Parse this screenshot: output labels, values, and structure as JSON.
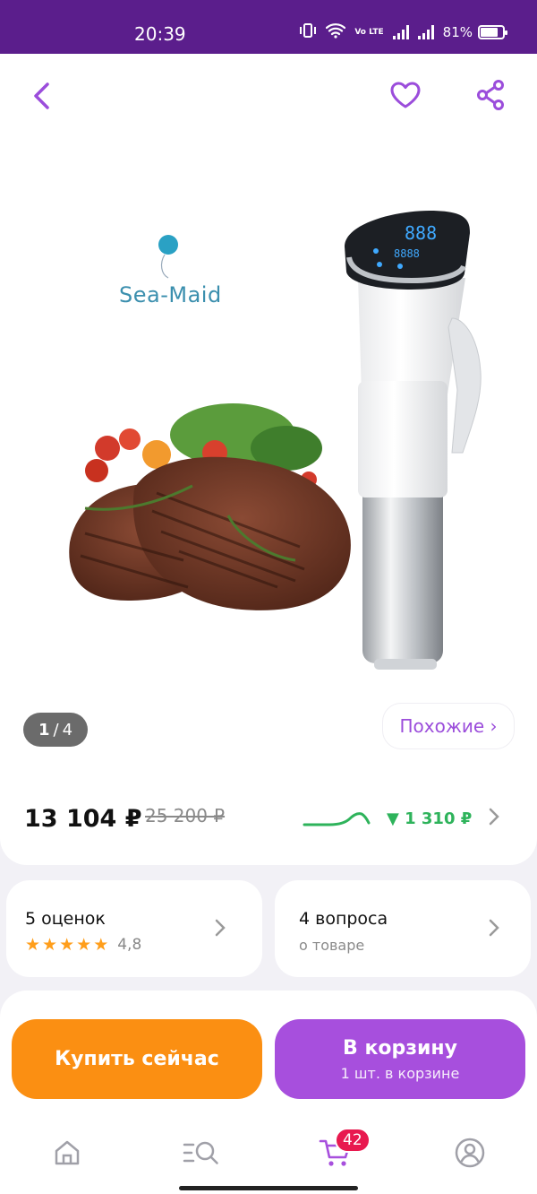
{
  "status_bar": {
    "time": "20:39",
    "volte": "Vo LTE",
    "battery": "81%",
    "battery_level": 0.81
  },
  "product": {
    "brand_logo": "Sea-Maid",
    "gallery": {
      "current": "1",
      "separator": "/",
      "total": "4"
    },
    "similar_label": "Похожие ›",
    "price": "13 104 ₽",
    "old_price": "25 200 ₽",
    "price_drop": "▼ 1 310 ₽"
  },
  "reviews": {
    "title": "5 оценок",
    "rating": "4,8",
    "stars": 5
  },
  "questions": {
    "title": "4 вопроса",
    "subtitle": "о товаре"
  },
  "actions": {
    "buy_now": "Купить сейчас",
    "add_to_cart": "В корзину",
    "cart_count_text": "1 шт. в корзине"
  },
  "tabbar": {
    "cart_badge": "42"
  },
  "colors": {
    "accent": "#a74fdd",
    "status_bar": "#5b1e8c",
    "buy_button": "#fb8f12",
    "price_drop": "#2eb35b",
    "badge": "#e8194f"
  },
  "icons": [
    "back-icon",
    "heart-icon",
    "share-icon",
    "chevron-right-icon",
    "star-icon",
    "home-icon",
    "catalog-search-icon",
    "cart-icon",
    "profile-icon"
  ]
}
